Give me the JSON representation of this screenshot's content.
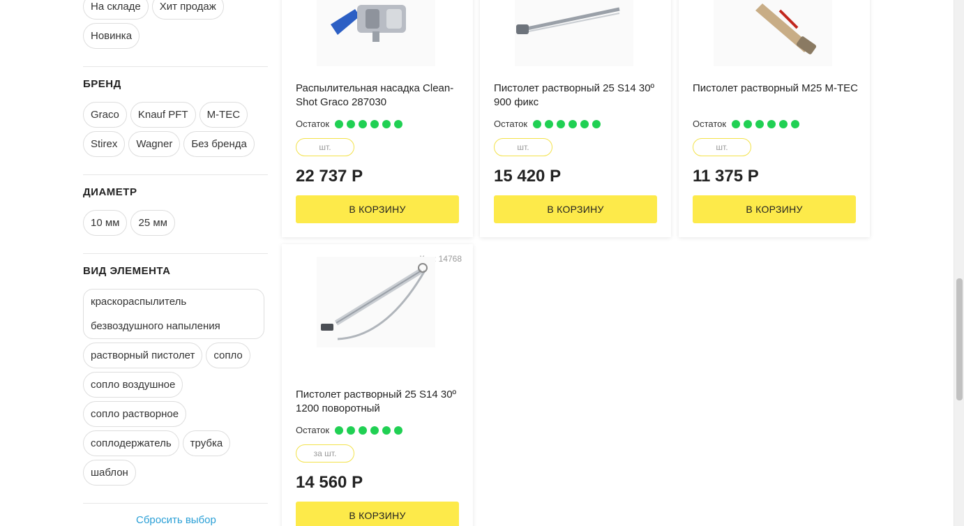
{
  "filters": {
    "availability_chips": [
      "На складе",
      "Хит продаж",
      "Новинка"
    ],
    "brand": {
      "title": "БРЕНД",
      "chips": [
        "Graco",
        "Knauf PFT",
        "M-TEC",
        "Stirex",
        "Wagner",
        "Без бренда"
      ]
    },
    "diameter": {
      "title": "ДИАМЕТР",
      "chips": [
        "10 мм",
        "25 мм"
      ]
    },
    "element_type": {
      "title": "ВИД ЭЛЕМЕНТА",
      "chip_multiline": [
        "краскораспылитель",
        "безвоздушного напыления"
      ],
      "chips": [
        "растворный пистолет",
        "сопло",
        "сопло воздушное",
        "сопло растворное",
        "соплодержатель",
        "трубка",
        "шаблон"
      ]
    },
    "reset_label": "Сбросить выбор"
  },
  "products": [
    {
      "name": "Распылительная насадка Clean-Shot Graco 287030",
      "stock_label": "Остаток",
      "stock_level": 6,
      "qty_label": "шт.",
      "price": "22 737 Р",
      "cart_label": "В КОРЗИНУ",
      "image_icon": "spray-nozzle-icon"
    },
    {
      "name": "Пистолет растворный 25 S14 30º 900 фикс",
      "stock_label": "Остаток",
      "stock_level": 6,
      "qty_label": "шт.",
      "price": "15 420 Р",
      "cart_label": "В КОРЗИНУ",
      "image_icon": "mortar-gun-icon"
    },
    {
      "name": "Пистолет растворный M25 M-TEC",
      "stock_label": "Остаток",
      "stock_level": 6,
      "qty_label": "шт.",
      "price": "11 375 Р",
      "cart_label": "В КОРЗИНУ",
      "image_icon": "mortar-gun-brown-icon"
    },
    {
      "code": "Код: 14768",
      "name": "Пистолет растворный 25 S14 30º 1200 поворотный",
      "stock_label": "Остаток",
      "stock_level": 6,
      "qty_label": "за шт.",
      "price": "14 560 Р",
      "cart_label": "В КОРЗИНУ",
      "image_icon": "mortar-gun-swivel-icon"
    }
  ],
  "colors": {
    "accent_yellow": "#fdea4a",
    "stock_green": "#20d053",
    "link_blue": "#2a9fd6"
  }
}
